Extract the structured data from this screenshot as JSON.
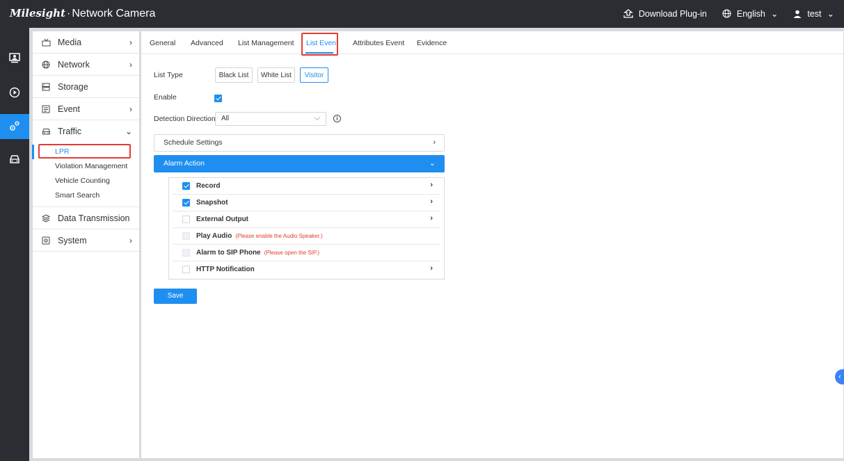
{
  "app": {
    "brand": "Milesight",
    "title": "Network Camera"
  },
  "header": {
    "download_label": "Download Plug-in",
    "language_label": "English",
    "user_label": "test"
  },
  "rail": {
    "icons": [
      "live-view-icon",
      "playback-icon",
      "settings-icon",
      "vehicle-icon"
    ],
    "active": "settings-icon"
  },
  "sidebar": {
    "items": [
      {
        "label": "Media",
        "icon": "media-icon",
        "arrow": "›"
      },
      {
        "label": "Network",
        "icon": "globe-icon",
        "arrow": "›"
      },
      {
        "label": "Storage",
        "icon": "storage-icon",
        "arrow": ""
      },
      {
        "label": "Event",
        "icon": "event-icon",
        "arrow": "›"
      },
      {
        "label": "Traffic",
        "icon": "car-icon",
        "arrow": "⌄"
      },
      {
        "label": "Data Transmission",
        "icon": "layers-icon",
        "arrow": ""
      },
      {
        "label": "System",
        "icon": "gear-icon",
        "arrow": "›"
      }
    ],
    "traffic_sub": [
      "LPR",
      "Violation Management",
      "Vehicle Counting",
      "Smart Search"
    ]
  },
  "tabs": [
    "General",
    "Advanced",
    "List Management",
    "List Event",
    "Attributes Event",
    "Evidence"
  ],
  "active_tab": "List Event",
  "form": {
    "list_type_label": "List Type",
    "list_types": [
      "Black List",
      "White List",
      "Visitor"
    ],
    "list_type_selected": "Visitor",
    "enable_label": "Enable",
    "enable_checked": true,
    "detection_label": "Detection Direction",
    "detection_value": "All",
    "schedule_label": "Schedule Settings",
    "alarm_label": "Alarm Action"
  },
  "alarm_actions": [
    {
      "label": "Record",
      "checked": true,
      "note": "",
      "arrow": "›"
    },
    {
      "label": "Snapshot",
      "checked": true,
      "note": "",
      "arrow": "›"
    },
    {
      "label": "External Output",
      "checked": false,
      "note": "",
      "arrow": "›"
    },
    {
      "label": "Play Audio",
      "checked": false,
      "note": "(Please enable the Audio Speaker.)",
      "arrow": ""
    },
    {
      "label": "Alarm to SIP Phone",
      "checked": false,
      "note": "(Please open the SIP.)",
      "arrow": ""
    },
    {
      "label": "HTTP Notification",
      "checked": false,
      "note": "",
      "arrow": "›"
    }
  ],
  "save_label": "Save",
  "edge_toggle": "‹",
  "colors": {
    "accent": "#1e8ff0",
    "header_bg": "#2b2d33",
    "highlight_red": "#e33b33"
  }
}
